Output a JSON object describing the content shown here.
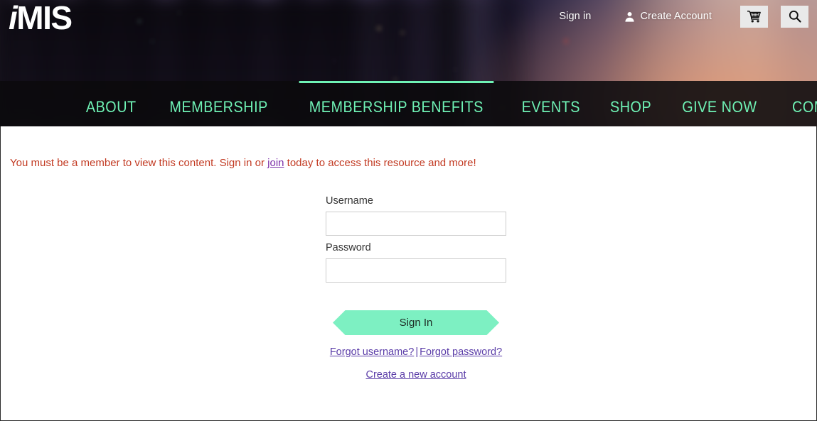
{
  "site": {
    "logo_text": "iMIS",
    "logo_initial": "i",
    "logo_rest": "MIS"
  },
  "header": {
    "utility": {
      "sign_in_label": "Sign in",
      "create_account_label": "Create Account",
      "person_icon": "person-icon",
      "cart_icon": "shopping-cart-icon",
      "search_icon": "search-icon"
    },
    "nav": {
      "items": [
        {
          "label": "ABOUT",
          "active": false
        },
        {
          "label": "MEMBERSHIP",
          "active": false
        },
        {
          "label": "MEMBERSHIP BENEFITS",
          "active": true
        },
        {
          "label": "EVENTS",
          "active": false
        },
        {
          "label": "SHOP",
          "active": false
        },
        {
          "label": "GIVE NOW",
          "active": false
        },
        {
          "label": "COMMUNITIES",
          "active": false
        }
      ],
      "active_index": 2
    }
  },
  "content": {
    "alert": {
      "prefix": "You must be a member to view this content. Sign in or ",
      "link_label": "join",
      "suffix": " today to access this resource and more!"
    },
    "form": {
      "username_label": "Username",
      "username_value": "",
      "username_placeholder": "",
      "password_label": "Password",
      "password_value": "",
      "password_placeholder": "",
      "submit_label": "Sign In",
      "forgot_username_label": "Forgot username?",
      "separator": "|",
      "forgot_password_label": "Forgot password?",
      "create_account_label": "Create a new account"
    }
  },
  "colors": {
    "accent_mint": "#7df0c2",
    "nav_link": "#6ff2b5",
    "alert_text": "#c23a22",
    "link_purple": "#5b3da8",
    "nav_bar_bg": "#0b0a0c",
    "icon_button_bg": "#e9e9e9"
  }
}
